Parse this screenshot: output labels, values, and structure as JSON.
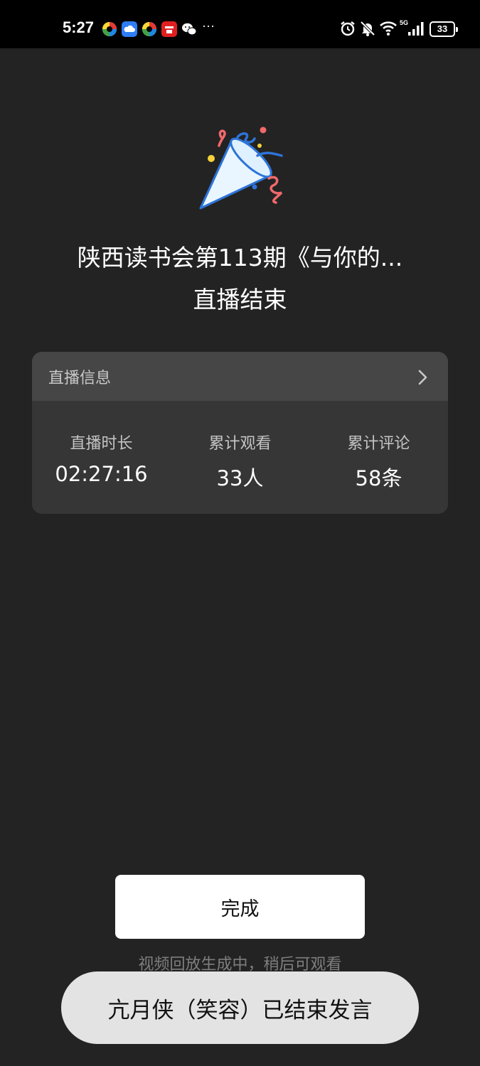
{
  "status_bar": {
    "time": "5:27",
    "more": "···",
    "battery": "33",
    "network": "5G",
    "app_icons": [
      "colorful-app-icon",
      "cloud-app-icon",
      "colorful-app-icon",
      "red-app-icon",
      "wechat-icon"
    ],
    "indicator_icons": [
      "alarm-icon",
      "mute-bell-icon",
      "wifi-icon",
      "signal-icon",
      "battery-icon"
    ]
  },
  "main": {
    "celebration_icon": "party-popper-icon",
    "live_title": "陕西读书会第113期《与你的...",
    "end_title": "直播结束"
  },
  "info_card": {
    "header_label": "直播信息",
    "stats": [
      {
        "label": "直播时长",
        "value": "02:27:16"
      },
      {
        "label": "累计观看",
        "value": "33人"
      },
      {
        "label": "累计评论",
        "value": "58条"
      }
    ]
  },
  "footer": {
    "done_label": "完成",
    "hint": "视频回放生成中，稍后可观看",
    "toast": "亢月侠（笑容）已结束发言"
  },
  "colors": {
    "background": "#232323",
    "card": "#363636",
    "card_header": "#464646",
    "button": "#ffffff",
    "toast": "#e3e3e3"
  }
}
